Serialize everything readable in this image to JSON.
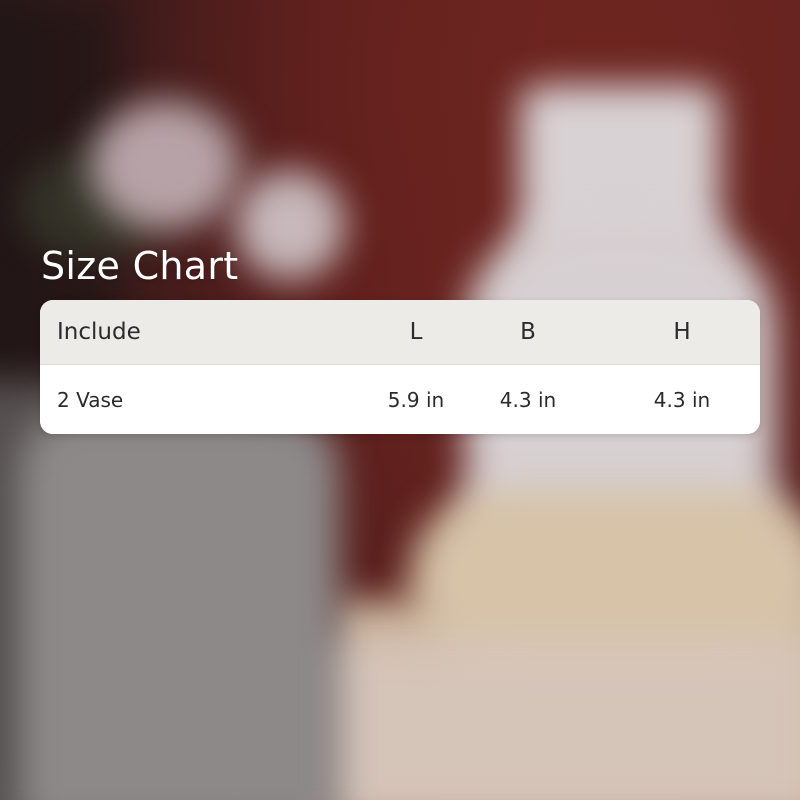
{
  "title": "Size Chart",
  "table": {
    "headers": [
      "Include",
      "L",
      "B",
      "H"
    ],
    "rows": [
      [
        "2 Vase",
        "5.9 in",
        "4.3 in",
        "4.3 in"
      ]
    ]
  },
  "colors": {
    "background_wall": "#6a2420",
    "header_row": "#ecebe8",
    "body_row": "#ffffff",
    "text": "#2b2b2b",
    "title_text": "#ffffff"
  }
}
